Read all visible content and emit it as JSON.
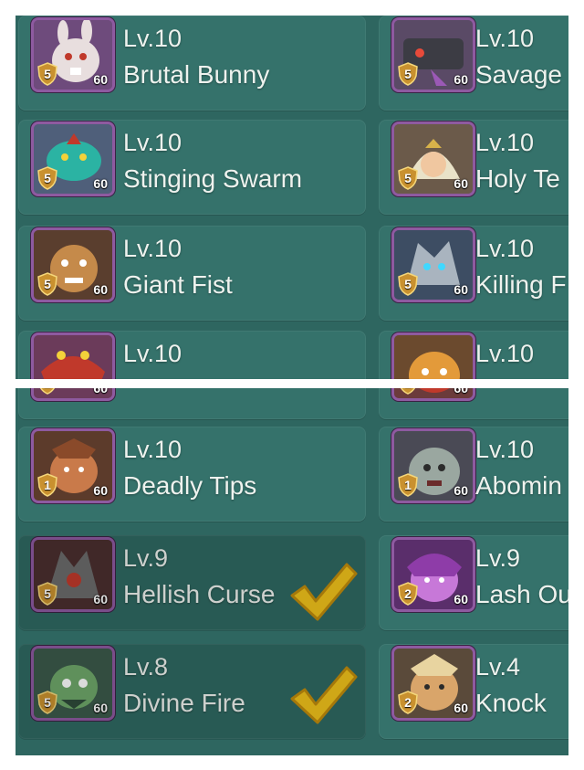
{
  "top_screen": {
    "cards": [
      {
        "level": "Lv.10",
        "name": "Brutal Bunny",
        "rank": "5",
        "cap": "60"
      },
      {
        "level": "Lv.10",
        "name": "Savage",
        "rank": "5",
        "cap": "60"
      },
      {
        "level": "Lv.10",
        "name": "Stinging Swarm",
        "rank": "5",
        "cap": "60"
      },
      {
        "level": "Lv.10",
        "name": "Holy Te",
        "rank": "5",
        "cap": "60"
      },
      {
        "level": "Lv.10",
        "name": "Giant Fist",
        "rank": "5",
        "cap": "60"
      },
      {
        "level": "Lv.10",
        "name": "Killing F",
        "rank": "5",
        "cap": "60"
      },
      {
        "level": "Lv.10",
        "name": "",
        "rank": "",
        "cap": ""
      },
      {
        "level": "Lv.10",
        "name": "",
        "rank": "",
        "cap": ""
      }
    ]
  },
  "bottom_screen": {
    "cards": [
      {
        "level": "",
        "name": "",
        "rank": "2",
        "cap": "60"
      },
      {
        "level": "",
        "name": "",
        "rank": "1",
        "cap": "60"
      },
      {
        "level": "Lv.10",
        "name": "Deadly Tips",
        "rank": "1",
        "cap": "60"
      },
      {
        "level": "Lv.10",
        "name": "Abomin",
        "rank": "1",
        "cap": "60"
      },
      {
        "level": "Lv.9",
        "name": "Hellish Curse",
        "rank": "5",
        "cap": "60",
        "selected": true
      },
      {
        "level": "Lv.9",
        "name": "Lash Ou",
        "rank": "2",
        "cap": "60"
      },
      {
        "level": "Lv.8",
        "name": "Divine Fire",
        "rank": "5",
        "cap": "60",
        "selected": true
      },
      {
        "level": "Lv.4",
        "name": "Knock",
        "rank": "2",
        "cap": "60"
      }
    ]
  },
  "colors": {
    "panel": "#2e6660",
    "card": "#35726b",
    "portrait_frame": "#8e5aa0",
    "rank_badge": "#d8a640",
    "check": "#f1c21b"
  },
  "icons": {
    "rank": "shield-badge-icon",
    "selected": "checkmark-icon"
  }
}
